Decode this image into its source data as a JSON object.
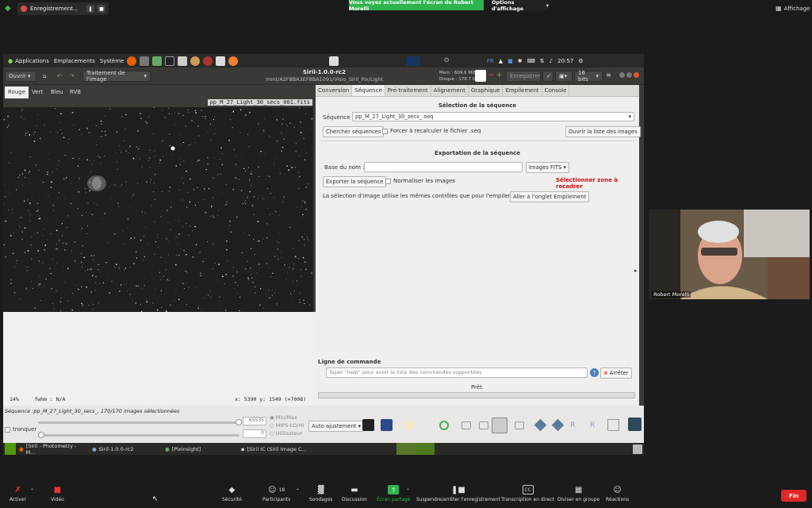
{
  "zoom": {
    "recording_label": "Enregistrement...",
    "share_banner": "Vous voyez actuellement l'écran de Robert Morelli",
    "view_options": "Options d'affichage",
    "display_label": "Affichage",
    "participant_name": "Robert Morelli",
    "participants_count": "18",
    "toolbar": [
      {
        "label": "Activer",
        "icon": "mic-muted-icon"
      },
      {
        "label": "Vidéo",
        "icon": "video-muted-icon"
      },
      {
        "label": "Sécurité",
        "icon": "shield-icon"
      },
      {
        "label": "Participants",
        "icon": "people-icon"
      },
      {
        "label": "Sondages",
        "icon": "poll-icon"
      },
      {
        "label": "Discussion",
        "icon": "chat-icon"
      },
      {
        "label": "Écran partagé",
        "icon": "share-screen-icon"
      },
      {
        "label": "Suspendre/arrêter l'enregistrement",
        "icon": "pause-record-icon"
      },
      {
        "label": "Transcription en direct",
        "icon": "cc-icon"
      },
      {
        "label": "Diviser en groupe",
        "icon": "breakout-icon"
      },
      {
        "label": "Réactions",
        "icon": "reaction-icon"
      }
    ],
    "end_label": "Fin"
  },
  "ubuntu": {
    "menu_applications": "Applications",
    "menu_places": "Emplacements",
    "menu_system": "Système",
    "lang": "FR",
    "clock": "20:57"
  },
  "siril": {
    "open_label": "Ouvrir",
    "image_processing": "Traitement de l'image",
    "title": "Siril-1.0.0-rc2",
    "path": "/mnt/A2F8BA3EF8BA1091/Visio_Siril_Pix/Light",
    "mem": "Mem : 609.6 MiB",
    "disk": "Disque : 178.7 GB",
    "save_label": "Enregistrer",
    "bits_label": "16 bits",
    "channel_tabs": [
      "Rouge",
      "Vert",
      "Bleu",
      "RVB"
    ],
    "file_name": "pp_M_27_Light_30_secs_001.fits",
    "status_zoom": "14%",
    "status_fwhm": "fwhm : N/A",
    "status_coords": "x: 5390 y: 1549 (=7008)",
    "right_tabs": [
      "Conversion",
      "Séquence",
      "Pré-traitement",
      "Alignement",
      "Graphique",
      "Empilement",
      "Console"
    ],
    "active_right_tab": 1,
    "seq_section_title": "Sélection de la séquence",
    "seq_label": "Séquence :",
    "seq_value": "pp_M_27_Light_30_secs_.seq",
    "search_seq_btn": "Chercher séquences",
    "force_recalc_label": "Forcer à recalculer le fichier .seq",
    "open_image_list_btn": "Ouvrir la liste des images",
    "export_section_title": "Exportation de la séquence",
    "base_name_label": "Base du nom :",
    "format_value": "Images FITS",
    "export_btn": "Exporter la séquence",
    "normalize_label": "Normaliser les images",
    "crop_zone_warning": "Sélectionner zone à recadrer",
    "selection_note": "La sélection d'image utilise les mêmes contrôles que pour l'empilement :",
    "goto_stack_btn": "Aller à l'onglet Empilement",
    "cmd_section_title": "Ligne de commande",
    "cmd_placeholder": "Taper \"help\" pour avoir la liste des commandes supportées",
    "stop_btn": "Arrêter",
    "ready_status": "Prêt.",
    "sequence_status": "Séquence :pp_M_27_Light_30_secs_, 170/170 images sélectionnées",
    "truncate_label": "tronquer",
    "max_value": "65535",
    "min_value": "0",
    "scale_options": [
      "Min/Max",
      "MIPS-LO/HI",
      "Utilisateur"
    ],
    "auto_adjust": "Auto ajustement"
  },
  "taskbar": [
    {
      "label": "[Siril - Photometry - M..."
    },
    {
      "label": "Siril-1.0.0-rc2"
    },
    {
      "label": "[PixInsight]"
    },
    {
      "label": "[Siril IC (Siril Image C..."
    }
  ],
  "colors": {
    "accent_green": "#2fb34e",
    "end_red": "#e02828",
    "warning_red": "#cc1111"
  }
}
